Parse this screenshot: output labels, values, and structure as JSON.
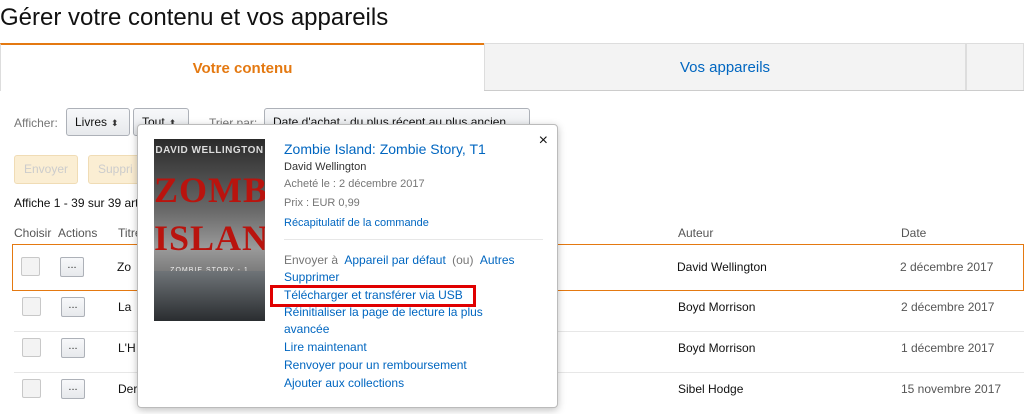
{
  "page": {
    "title": "Gérer votre contenu et vos appareils"
  },
  "tabs": {
    "active": "Votre contenu",
    "inactive": "Vos appareils"
  },
  "filters": {
    "show_label": "Afficher:",
    "type_value": "Livres",
    "scope_value": "Tout",
    "sort_label": "Trier par:",
    "sort_value": "Date d'achat : du plus récent au plus ancien"
  },
  "toolbar": {
    "send_label": "Envoyer",
    "delete_label": "Suppri"
  },
  "summary": "Affiche 1 - 39 sur 39 art",
  "table": {
    "headers": {
      "choose": "Choisir",
      "actions": "Actions",
      "title": "Titre",
      "author": "Auteur",
      "date": "Date"
    },
    "action_label": "...",
    "rows": [
      {
        "title": "Zo",
        "author": "David Wellington",
        "date": "2 décembre 2017"
      },
      {
        "title": "La",
        "author": "Boyd Morrison",
        "date": "2 décembre 2017"
      },
      {
        "title": "L'H",
        "author": "Boyd Morrison",
        "date": "1 décembre 2017"
      },
      {
        "title": "Der",
        "author": "Sibel Hodge",
        "date": "15 novembre 2017"
      }
    ]
  },
  "popover": {
    "close": "×",
    "cover": {
      "author": "DAVID WELLINGTON",
      "title_line1": "ZOMBIE",
      "title_line2": "ISLAND",
      "series": "ZOMBIE STORY - 1"
    },
    "title": "Zombie Island: Zombie Story, T1",
    "author": "David Wellington",
    "purchased": "Acheté le : 2 décembre 2017",
    "price": "Prix : EUR 0,99",
    "order_summary": "Récapitulatif de la commande",
    "send_to": "Envoyer à",
    "default_device": "Appareil par défaut",
    "or": "(ou)",
    "other": "Autres",
    "actions": {
      "delete": "Supprimer",
      "download_usb": "Télécharger et transférer via USB",
      "reset_line1": "Réinitialiser la page de lecture la plus",
      "reset_line2": "avancée",
      "read_now": "Lire maintenant",
      "refund": "Renvoyer pour un remboursement",
      "collections": "Ajouter aux collections"
    }
  },
  "colors": {
    "accent": "#e47911",
    "link": "#0066c0",
    "highlight": "#e00000"
  }
}
